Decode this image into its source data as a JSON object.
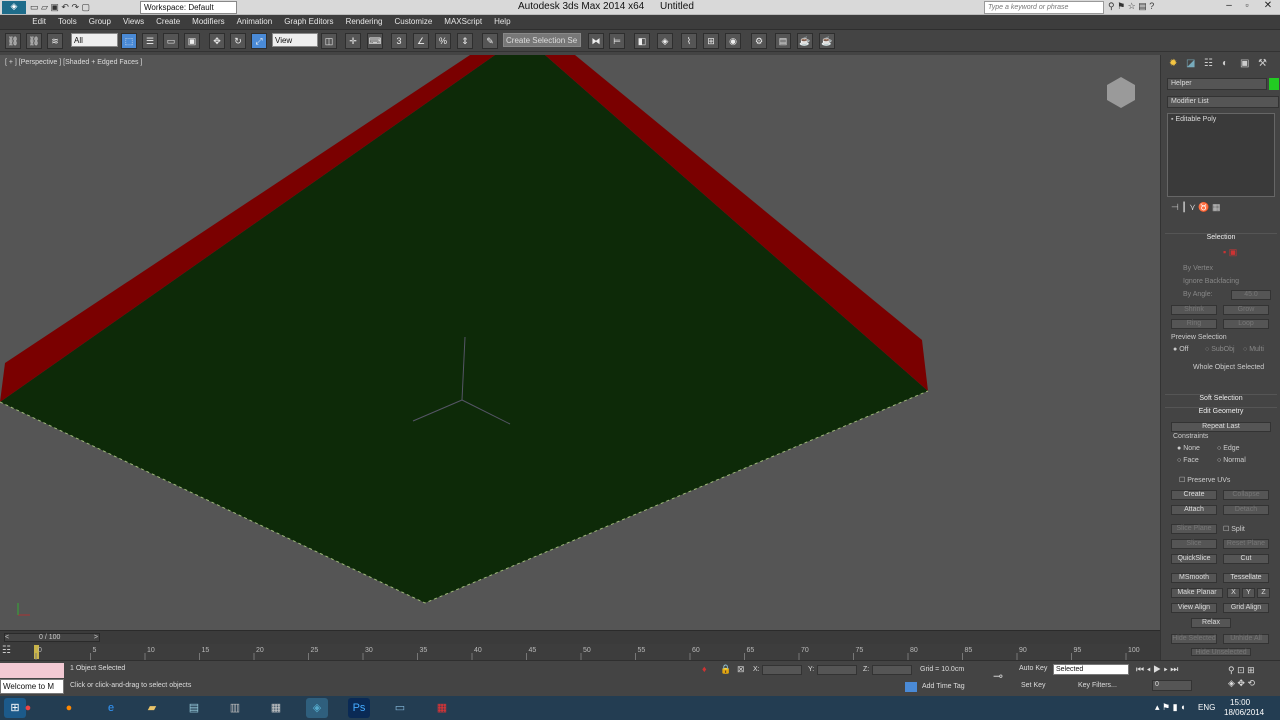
{
  "window": {
    "title": "Autodesk 3ds Max  2014 x64",
    "document": "Untitled",
    "workspace": "Workspace: Default",
    "search_placeholder": "Type a keyword or phrase"
  },
  "menu": [
    "Edit",
    "Tools",
    "Group",
    "Views",
    "Create",
    "Modifiers",
    "Animation",
    "Graph Editors",
    "Rendering",
    "Customize",
    "MAXScript",
    "Help"
  ],
  "toolbar": {
    "filter": "All",
    "ref_coord": "View",
    "named_selection": "Create Selection Se"
  },
  "viewport": {
    "label": "[ + ] [Perspective ] [Shaded + Edged Faces ]"
  },
  "command_panel": {
    "object_name": "Helper",
    "modifier_list": "Modifier List",
    "stack_item": "Editable Poly",
    "selection": {
      "title": "Selection",
      "by_vertex": "By Vertex",
      "ignore_backfacing": "Ignore Backfacing",
      "by_angle": "By Angle:",
      "angle": "45.0",
      "shrink": "Shrink",
      "grow": "Grow",
      "ring": "Ring",
      "loop": "Loop",
      "preview": "Preview Selection",
      "off": "Off",
      "subobj": "SubObj",
      "multi": "Multi",
      "whole": "Whole Object Selected"
    },
    "soft_selection": "Soft Selection",
    "edit_geometry": {
      "title": "Edit Geometry",
      "repeat_last": "Repeat Last",
      "constraints": "Constraints",
      "none": "None",
      "edge": "Edge",
      "face": "Face",
      "normal": "Normal",
      "preserve_uvs": "Preserve UVs",
      "create": "Create",
      "collapse": "Collapse",
      "attach": "Attach",
      "detach": "Detach",
      "slice_plane": "Slice Plane",
      "split": "Split",
      "slice": "Slice",
      "reset_plane": "Reset Plane",
      "quickslice": "QuickSlice",
      "cut": "Cut",
      "msmooth": "MSmooth",
      "tessellate": "Tessellate",
      "make_planar": "Make Planar",
      "x": "X",
      "y": "Y",
      "z": "Z",
      "view_align": "View Align",
      "grid_align": "Grid Align",
      "relax": "Relax",
      "hide_selected": "Hide Selected",
      "unhide_all": "Unhide All",
      "hide_unselected": "Hide Unselected"
    }
  },
  "timeline": {
    "frame": "0 / 100",
    "ticks": [
      "0",
      "5",
      "10",
      "15",
      "20",
      "25",
      "30",
      "35",
      "40",
      "45",
      "50",
      "55",
      "60",
      "65",
      "70",
      "75",
      "80",
      "85",
      "90",
      "95",
      "100"
    ]
  },
  "status": {
    "maxscript": "Welcome to M",
    "objects": "1 Object Selected",
    "prompt": "Click or click-and-drag to select objects",
    "x_label": "X:",
    "y_label": "Y:",
    "z_label": "Z:",
    "grid": "Grid = 10.0cm",
    "add_time_tag": "Add Time Tag",
    "auto_key": "Auto Key",
    "selected": "Selected",
    "set_key": "Set Key",
    "key_filters": "Key Filters...",
    "frame_field": "0"
  },
  "taskbar": {
    "lang": "ENG",
    "time": "15:00",
    "date": "18/06/2014"
  },
  "colors": {
    "plane": "#0d2a08",
    "edge": "#7a0000",
    "viewport": "#555555"
  }
}
